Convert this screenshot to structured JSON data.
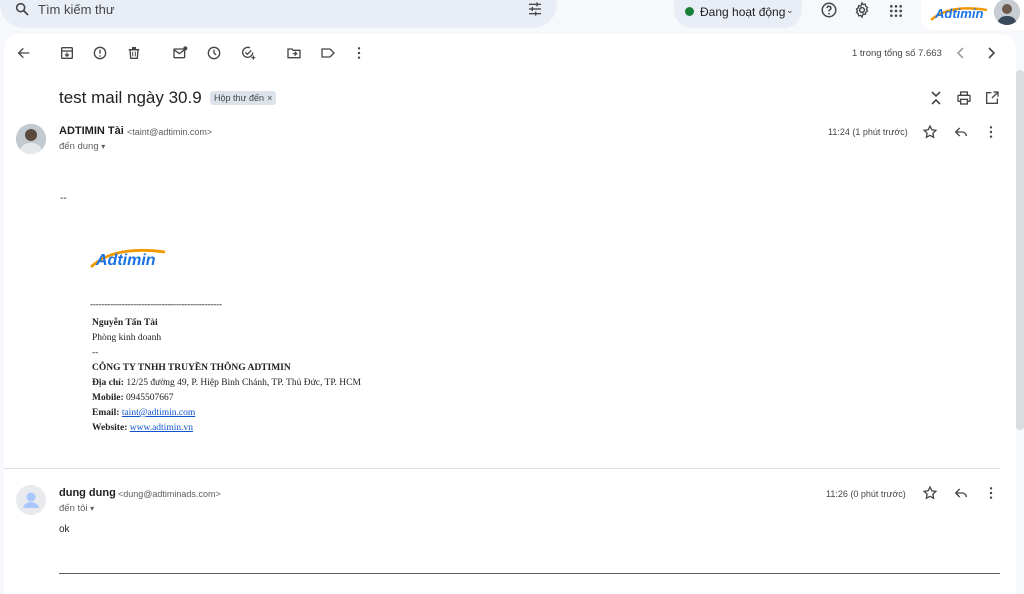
{
  "search": {
    "placeholder": "Tìm kiếm thư",
    "icon": "search-icon",
    "filter_icon": "tune-icon"
  },
  "status": {
    "label": "Đang hoạt động",
    "color": "#188038"
  },
  "top_icons": [
    "help-icon",
    "settings-icon",
    "apps-icon"
  ],
  "brand": {
    "logo_text": "Adtimin",
    "colors": {
      "blue": "#1a73e8",
      "orange": "#f29900"
    }
  },
  "toolbar": {
    "icons": [
      "back-arrow-icon",
      "archive-icon",
      "report-spam-icon",
      "delete-icon",
      "mark-unread-icon",
      "snooze-icon",
      "add-to-tasks-icon",
      "move-to-icon",
      "label-icon",
      "more-vert-icon"
    ],
    "pager_text": "1 trong tổng số 7.663"
  },
  "thread": {
    "subject": "test mail ngày 30.9",
    "label": "Hộp thư đến",
    "label_close": "×"
  },
  "messages": [
    {
      "sender": "ADTIMIN Tài",
      "email": "<taint@adtimin.com>",
      "to": "đến dung",
      "time": "11:24 (1 phút trước)",
      "body_dash": "--",
      "signature": {
        "logo_text": "Adtimin",
        "rule": "----------------------------------------------",
        "name": "Nguyễn Tấn Tài",
        "department": "Phòng kinh doanh",
        "dash": "--",
        "company": "CÔNG TY TNHH TRUYỀN THÔNG ADTIMIN",
        "address_label": "Địa chỉ:",
        "address": "12/25 đường 49, P. Hiệp Bình Chánh, TP. Thủ Đức, TP. HCM",
        "mobile_label": "Mobile:",
        "mobile": "0945507667",
        "email_label": "Email:",
        "email": "taint@adtimin.com",
        "website_label": "Website:",
        "website": "www.adtimin.vn"
      }
    },
    {
      "sender": "dung dung",
      "email": "<dung@adtiminads.com>",
      "to": "đến tôi",
      "time": "11:26 (0 phút trước)",
      "body": "ok"
    }
  ]
}
